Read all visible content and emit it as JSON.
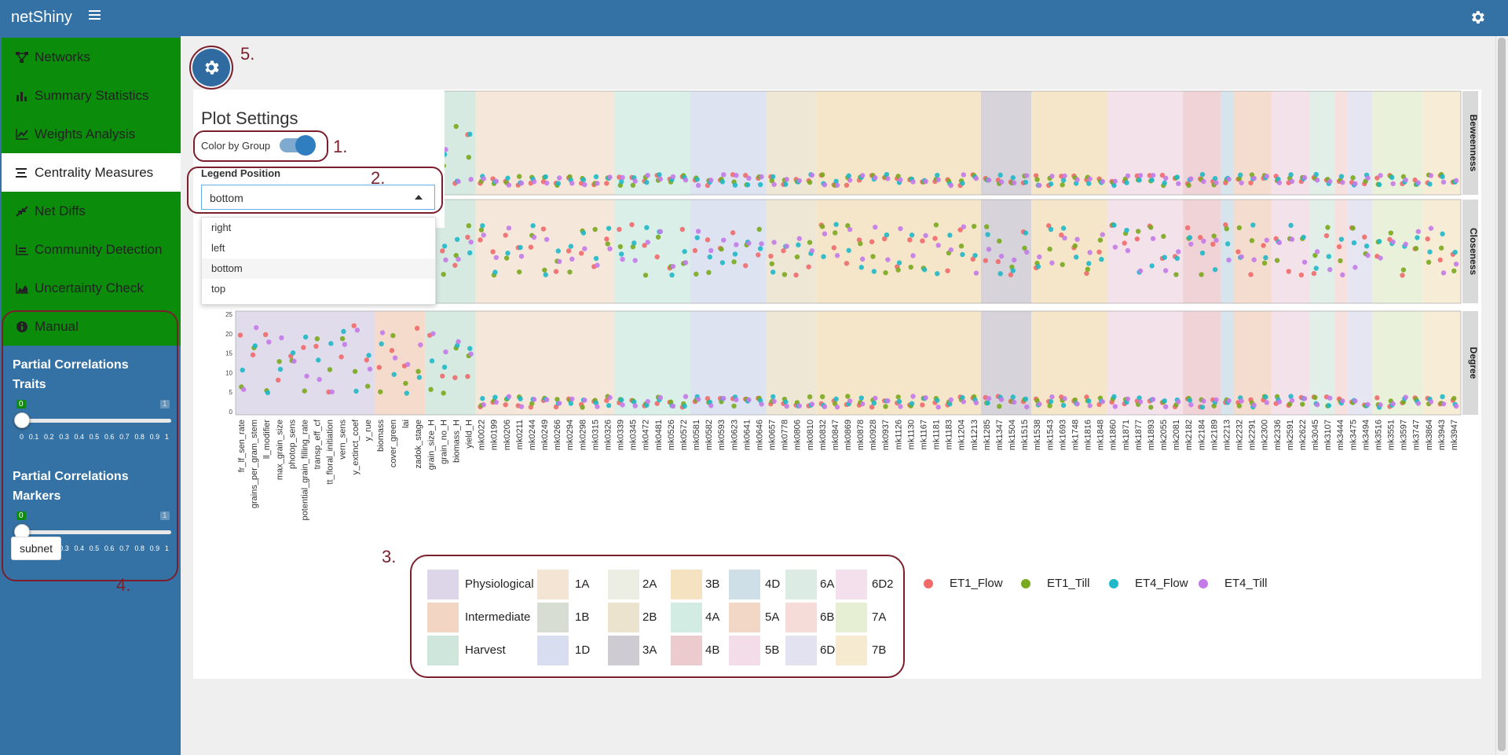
{
  "app": {
    "title": "netShiny"
  },
  "sidebar": {
    "menu": [
      {
        "label": "Networks",
        "icon": "network-icon",
        "active": false
      },
      {
        "label": "Summary Statistics",
        "icon": "bar-chart-icon",
        "active": false
      },
      {
        "label": "Weights Analysis",
        "icon": "line-chart-icon",
        "active": false
      },
      {
        "label": "Centrality Measures",
        "icon": "align-left-icon",
        "active": true
      },
      {
        "label": "Net Diffs",
        "icon": "compress-icon",
        "active": false
      },
      {
        "label": "Community Detection",
        "icon": "line-chart-icon",
        "active": false
      },
      {
        "label": "Uncertainty Check",
        "icon": "area-chart-icon",
        "active": false
      },
      {
        "label": "Manual",
        "icon": "info-circle-icon",
        "active": false
      }
    ],
    "traits_slider": {
      "title": "Partial Correlations Traits",
      "min": "0",
      "max": "1",
      "value": 0
    },
    "markers_slider": {
      "title": "Partial Correlations Markers",
      "min": "0",
      "max": "1",
      "value": 0
    },
    "ticks": [
      "0",
      "0.1",
      "0.2",
      "0.3",
      "0.4",
      "0.5",
      "0.6",
      "0.7",
      "0.8",
      "0.9",
      "1"
    ],
    "subnet_label": "subnet"
  },
  "annotations": {
    "a1": "1.",
    "a2": "2.",
    "a3": "3.",
    "a4": "4.",
    "a5": "5."
  },
  "settings": {
    "title": "Plot Settings",
    "color_by_group_label": "Color by Group",
    "color_by_group_on": true,
    "legend_position_label": "Legend Position",
    "legend_position_value": "bottom",
    "legend_position_options": [
      "right",
      "left",
      "bottom",
      "top"
    ]
  },
  "colors": {
    "ET1_Flow": "#f06a6a",
    "ET1_Till": "#7aa81e",
    "ET4_Flow": "#1fb8c8",
    "ET4_Till": "#c47ae8",
    "accent_red": "#7a1f2b",
    "sidebar_green": "#0b8c0b",
    "header_blue": "#3472a5"
  },
  "chart_data": {
    "type": "scatter",
    "facets": [
      "Beweenness",
      "Closeness",
      "Degree"
    ],
    "degree_axis_ticks": [
      "25",
      "20",
      "15",
      "10",
      "5",
      "0"
    ],
    "x_labels": [
      "fr_lf_sen_rate",
      "grains_per_gram_stem",
      "ll_modifier",
      "max_grain_size",
      "photop_sens",
      "potential_grain_filling_rate",
      "transp_eff_cf",
      "tt_floral_initiation",
      "vern_sens",
      "y_extinct_coef",
      "y_rue",
      "biomass",
      "cover_green",
      "lai",
      "zadok_stage",
      "grain_size_H",
      "grain_no_H",
      "biomass_H",
      "yield_H",
      "mk0022",
      "mk0199",
      "mk0206",
      "mk0211",
      "mk0244",
      "mk0249",
      "mk0266",
      "mk0294",
      "mk0298",
      "mk0315",
      "mk0326",
      "mk0339",
      "mk0345",
      "mk0472",
      "mk0481",
      "mk0526",
      "mk0572",
      "mk0581",
      "mk0582",
      "mk0593",
      "mk0623",
      "mk0641",
      "mk0646",
      "mk0657",
      "mk0778",
      "mk0806",
      "mk0810",
      "mk0832",
      "mk0847",
      "mk0869",
      "mk0878",
      "mk0928",
      "mk0937",
      "mk1126",
      "mk1130",
      "mk1167",
      "mk1181",
      "mk1183",
      "mk1204",
      "mk1213",
      "mk1285",
      "mk1347",
      "mk1504",
      "mk1515",
      "mk1538",
      "mk1543",
      "mk1693",
      "mk1748",
      "mk1816",
      "mk1848",
      "mk1860",
      "mk1871",
      "mk1877",
      "mk1893",
      "mk2055",
      "mk2081",
      "mk2182",
      "mk2184",
      "mk2189",
      "mk2213",
      "mk2232",
      "mk2291",
      "mk2300",
      "mk2336",
      "mk2591",
      "mk2622",
      "mk3045",
      "mk3107",
      "mk3444",
      "mk3475",
      "mk3494",
      "mk3516",
      "mk3551",
      "mk3597",
      "mk3747",
      "mk3864",
      "mk3943",
      "mk3947"
    ],
    "series": [
      {
        "name": "ET1_Flow"
      },
      {
        "name": "ET1_Till"
      },
      {
        "name": "ET4_Flow"
      },
      {
        "name": "ET4_Till"
      }
    ]
  },
  "legend": {
    "groups": [
      {
        "label": "Physiological",
        "color": "#dcd6e8"
      },
      {
        "label": "Intermediate",
        "color": "#f2d5c3"
      },
      {
        "label": "Harvest",
        "color": "#cfe6dd"
      },
      {
        "label": "1A",
        "color": "#f3e4d4"
      },
      {
        "label": "1B",
        "color": "#d8ddd4"
      },
      {
        "label": "1D",
        "color": "#d8def0"
      },
      {
        "label": "2A",
        "color": "#eceee4"
      },
      {
        "label": "2B",
        "color": "#ece3cf"
      },
      {
        "label": "3A",
        "color": "#cfcbd3"
      },
      {
        "label": "3B",
        "color": "#f4e2c0"
      },
      {
        "label": "4A",
        "color": "#d2ece4"
      },
      {
        "label": "4B",
        "color": "#eccbcf"
      },
      {
        "label": "4D",
        "color": "#cfdfe8"
      },
      {
        "label": "5A",
        "color": "#f2d6c6"
      },
      {
        "label": "5B",
        "color": "#f2dde8"
      },
      {
        "label": "6A",
        "color": "#dcece4"
      },
      {
        "label": "6B",
        "color": "#f6dcd8"
      },
      {
        "label": "6D1",
        "color": "#e2e2f0"
      },
      {
        "label": "6D2",
        "color": "#f4e0ec"
      },
      {
        "label": "7A",
        "color": "#e6eed4"
      },
      {
        "label": "7B",
        "color": "#f6ead0"
      }
    ],
    "series": [
      "ET1_Flow",
      "ET1_Till",
      "ET4_Flow",
      "ET4_Till"
    ]
  }
}
